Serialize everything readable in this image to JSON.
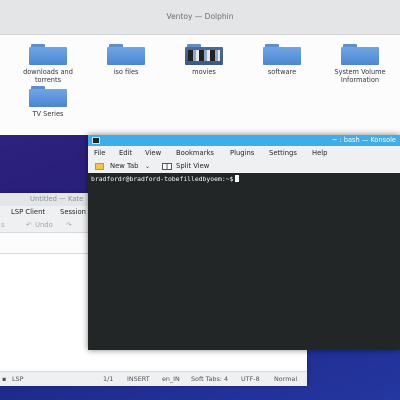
{
  "dolphin": {
    "title": "Ventoy — Dolphin",
    "items": [
      {
        "label": "downloads and torrents",
        "icon": "folder-icon"
      },
      {
        "label": "iso files",
        "icon": "folder-icon"
      },
      {
        "label": "movies",
        "icon": "folder-video-thumbnail-icon"
      },
      {
        "label": "software",
        "icon": "folder-icon"
      },
      {
        "label": "System Volume Information",
        "icon": "folder-icon"
      },
      {
        "label": "TV Series",
        "icon": "folder-icon"
      }
    ]
  },
  "kate": {
    "title": "Untitled — Kate",
    "menu": [
      "LSP Client",
      "Session"
    ],
    "toolbar": {
      "undo": "Undo"
    },
    "status": {
      "lsp": "LSP",
      "position": "1/1",
      "mode": "INSERT",
      "locale": "en_IN",
      "tabs": "Soft Tabs: 4",
      "encoding": "UTF-8",
      "syntax": "Normal"
    }
  },
  "konsole": {
    "title": "~ : bash — Konsole",
    "menu": [
      "File",
      "Edit",
      "View",
      "Bookmarks",
      "Plugins",
      "Settings",
      "Help"
    ],
    "toolbar": {
      "new_tab": "New Tab",
      "split_view": "Split View"
    },
    "prompt": "bradfordr@bradford-tobefilledbyoem:~$"
  }
}
